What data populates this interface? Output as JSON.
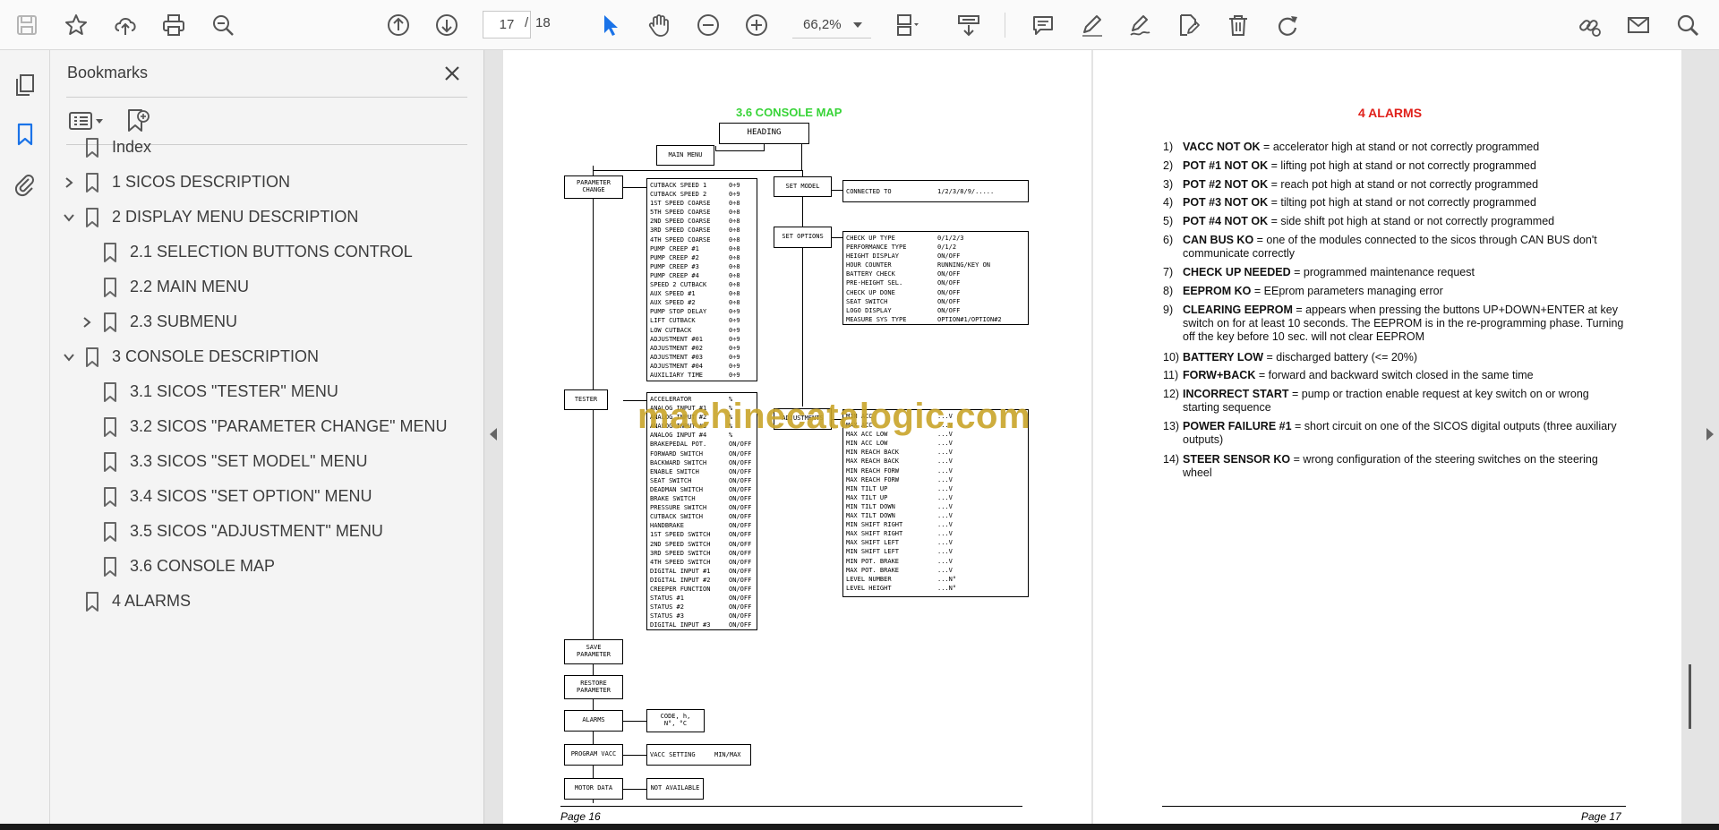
{
  "toolbar": {
    "page_current": "17",
    "page_sep": "/",
    "page_total": "18",
    "zoom": "66,2%",
    "accent": "#1a73e8"
  },
  "bookmarks": {
    "title": "Bookmarks",
    "items": [
      {
        "label": "Index",
        "level": 0,
        "chevron": "none"
      },
      {
        "label": "1 SICOS DESCRIPTION",
        "level": 0,
        "chevron": "right"
      },
      {
        "label": "2 DISPLAY MENU DESCRIPTION",
        "level": 0,
        "chevron": "down"
      },
      {
        "label": "2.1 SELECTION BUTTONS CONTROL",
        "level": 1,
        "chevron": "none"
      },
      {
        "label": "2.2 MAIN MENU",
        "level": 1,
        "chevron": "none"
      },
      {
        "label": "2.3 SUBMENU",
        "level": 1,
        "chevron": "right"
      },
      {
        "label": "3 CONSOLE DESCRIPTION",
        "level": 0,
        "chevron": "down"
      },
      {
        "label": "3.1 SICOS \"TESTER\" MENU",
        "level": 1,
        "chevron": "none"
      },
      {
        "label": "3.2 SICOS \"PARAMETER CHANGE\" MENU",
        "level": 1,
        "chevron": "none"
      },
      {
        "label": "3.3 SICOS \"SET MODEL\" MENU",
        "level": 1,
        "chevron": "none"
      },
      {
        "label": "3.4 SICOS \"SET OPTION\" MENU",
        "level": 1,
        "chevron": "none"
      },
      {
        "label": "3.5 SICOS \"ADJUSTMENT\" MENU",
        "level": 1,
        "chevron": "none"
      },
      {
        "label": "3.6 CONSOLE MAP",
        "level": 1,
        "chevron": "none"
      },
      {
        "label": "4 ALARMS",
        "level": 0,
        "chevron": "none"
      }
    ]
  },
  "page16": {
    "title": "3.6 CONSOLE MAP",
    "heading": "HEADING",
    "main_menu": "MAIN MENU",
    "parameter_change": "PARAMETER CHANGE",
    "set_model": "SET MODEL",
    "set_options": "SET OPTIONS",
    "tester": "TESTER",
    "adjustments": "ADJUSTMENTS",
    "save_parameter": "SAVE PARAMETER",
    "restore_parameter": "RESTORE PARAMETER",
    "alarms": "ALARMS",
    "program_vacc": "PROGRAM VACC",
    "motor_data": "MOTOR DATA",
    "connected_to": {
      "k": "CONNECTED TO",
      "v": "1/2/3/8/9/....."
    },
    "alarm_code": "CODE, h, N°, °C",
    "vacc_setting": {
      "k": "VACC SETTING",
      "v": "MIN/MAX"
    },
    "not_available": "NOT AVAILABLE",
    "param_list": [
      {
        "k": "CUTBACK SPEED 1",
        "v": "0÷9"
      },
      {
        "k": "CUTBACK SPEED 2",
        "v": "0÷9"
      },
      {
        "k": "1ST SPEED COARSE",
        "v": "0÷8"
      },
      {
        "k": "5TH SPEED COARSE",
        "v": "0÷8"
      },
      {
        "k": "2ND SPEED COARSE",
        "v": "0÷8"
      },
      {
        "k": "3RD SPEED COARSE",
        "v": "0÷8"
      },
      {
        "k": "4TH SPEED COARSE",
        "v": "0÷8"
      },
      {
        "k": "PUMP CREEP #1",
        "v": "0÷8"
      },
      {
        "k": "PUMP CREEP #2",
        "v": "0÷8"
      },
      {
        "k": "PUMP CREEP #3",
        "v": "0÷8"
      },
      {
        "k": "PUMP CREEP #4",
        "v": "0÷8"
      },
      {
        "k": "SPEED 2 CUTBACK",
        "v": "0÷8"
      },
      {
        "k": "AUX SPEED #1",
        "v": "0÷8"
      },
      {
        "k": "AUX SPEED #2",
        "v": "0÷8"
      },
      {
        "k": "PUMP STOP DELAY",
        "v": "0÷9"
      },
      {
        "k": "LIFT CUTBACK",
        "v": "0÷9"
      },
      {
        "k": "LOW CUTBACK",
        "v": "0÷9"
      },
      {
        "k": "ADJUSTMENT #01",
        "v": "0÷9"
      },
      {
        "k": "ADJUSTMENT #02",
        "v": "0÷9"
      },
      {
        "k": "ADJUSTMENT #03",
        "v": "0÷9"
      },
      {
        "k": "ADJUSTMENT #04",
        "v": "0÷9"
      },
      {
        "k": "AUXILIARY TIME",
        "v": "0÷9"
      }
    ],
    "option_list": [
      {
        "k": "CHECK UP TYPE",
        "v": "0/1/2/3"
      },
      {
        "k": "PERFORMANCE TYPE",
        "v": "0/1/2"
      },
      {
        "k": "HEIGHT DISPLAY",
        "v": "ON/OFF"
      },
      {
        "k": "HOUR COUNTER",
        "v": "RUNNING/KEY ON"
      },
      {
        "k": "BATTERY CHECK",
        "v": "ON/OFF"
      },
      {
        "k": "PRE-HEIGHT SEL.",
        "v": "ON/OFF"
      },
      {
        "k": "CHECK UP DONE",
        "v": "ON/OFF"
      },
      {
        "k": "SEAT SWITCH",
        "v": "ON/OFF"
      },
      {
        "k": "LOGO DISPLAY",
        "v": "ON/OFF"
      },
      {
        "k": "MEASURE SYS TYPE",
        "v": "OPTION#1/OPTION#2"
      }
    ],
    "tester_list": [
      {
        "k": "ACCELERATOR",
        "v": "%"
      },
      {
        "k": "ANALOG INPUT #1",
        "v": "%"
      },
      {
        "k": "ANALOG INPUT #2",
        "v": "%"
      },
      {
        "k": "ANALOG INPUT #3",
        "v": "%"
      },
      {
        "k": "ANALOG INPUT #4",
        "v": "%"
      },
      {
        "k": "BRAKEPEDAL POT.",
        "v": "ON/OFF"
      },
      {
        "k": "FORWARD SWITCH",
        "v": "ON/OFF"
      },
      {
        "k": "BACKWARD SWITCH",
        "v": "ON/OFF"
      },
      {
        "k": "ENABLE SWITCH",
        "v": "ON/OFF"
      },
      {
        "k": "SEAT SWITCH",
        "v": "ON/OFF"
      },
      {
        "k": "DEADMAN SWITCH",
        "v": "ON/OFF"
      },
      {
        "k": "BRAKE SWITCH",
        "v": "ON/OFF"
      },
      {
        "k": "PRESSURE SWITCH",
        "v": "ON/OFF"
      },
      {
        "k": "CUTBACK SWITCH",
        "v": "ON/OFF"
      },
      {
        "k": "HANDBRAKE",
        "v": "ON/OFF"
      },
      {
        "k": "1ST SPEED SWITCH",
        "v": "ON/OFF"
      },
      {
        "k": "2ND SPEED SWITCH",
        "v": "ON/OFF"
      },
      {
        "k": "3RD SPEED SWITCH",
        "v": "ON/OFF"
      },
      {
        "k": "4TH SPEED SWITCH",
        "v": "ON/OFF"
      },
      {
        "k": "DIGITAL INPUT #1",
        "v": "ON/OFF"
      },
      {
        "k": "DIGITAL INPUT #2",
        "v": "ON/OFF"
      },
      {
        "k": "CREEPER FUNCTION",
        "v": "ON/OFF"
      },
      {
        "k": "STATUS #1",
        "v": "ON/OFF"
      },
      {
        "k": "STATUS #2",
        "v": "ON/OFF"
      },
      {
        "k": "STATUS #3",
        "v": "ON/OFF"
      },
      {
        "k": "DIGITAL INPUT #3",
        "v": "ON/OFF"
      }
    ],
    "adjust_list": [
      {
        "k": "MIN ACC",
        "v": "...V"
      },
      {
        "k": "MAX ACC",
        "v": "...V"
      },
      {
        "k": "MAX ACC LOW",
        "v": "...V"
      },
      {
        "k": "MIN ACC LOW",
        "v": "...V"
      },
      {
        "k": "MIN REACH BACK",
        "v": "...V"
      },
      {
        "k": "MAX REACH BACK",
        "v": "...V"
      },
      {
        "k": "MIN REACH FORW",
        "v": "...V"
      },
      {
        "k": "MAX REACH FORW",
        "v": "...V"
      },
      {
        "k": "MIN TILT UP",
        "v": "...V"
      },
      {
        "k": "MAX TILT UP",
        "v": "...V"
      },
      {
        "k": "MIN TILT DOWN",
        "v": "...V"
      },
      {
        "k": "MAX TILT DOWN",
        "v": "...V"
      },
      {
        "k": "MIN SHIFT RIGHT",
        "v": "...V"
      },
      {
        "k": "MAX SHIFT RIGHT",
        "v": "...V"
      },
      {
        "k": "MAX SHIFT LEFT",
        "v": "...V"
      },
      {
        "k": "MIN SHIFT LEFT",
        "v": "...V"
      },
      {
        "k": "MIN POT. BRAKE",
        "v": "...V"
      },
      {
        "k": "MAX POT. BRAKE",
        "v": "...V"
      },
      {
        "k": "LEVEL NUMBER",
        "v": "...N°"
      },
      {
        "k": "LEVEL HEIGHT",
        "v": "...N°"
      }
    ],
    "watermark": "machinecatalogic.com",
    "footer": "Page 16"
  },
  "page17": {
    "title": "4 ALARMS",
    "items": [
      {
        "n": "1)",
        "b": "VACC NOT OK",
        "t": " = accelerator high at stand or not correctly programmed"
      },
      {
        "n": "2)",
        "b": "POT #1 NOT OK",
        "t": " = lifting pot high at stand or not correctly programmed"
      },
      {
        "n": "3)",
        "b": "POT #2 NOT OK",
        "t": " = reach pot high at stand or not correctly programmed"
      },
      {
        "n": "4)",
        "b": "POT #3 NOT OK",
        "t": " = tilting pot high at stand or not correctly programmed"
      },
      {
        "n": "5)",
        "b": "POT #4 NOT OK",
        "t": " = side shift pot high at stand or not correctly programmed"
      },
      {
        "n": "6)",
        "b": "CAN BUS KO",
        "t": " = one of the modules connected to the sicos through CAN BUS don't communicate correctly"
      },
      {
        "n": "7)",
        "b": "CHECK UP NEEDED",
        "t": " = programmed maintenance request"
      },
      {
        "n": "8)",
        "b": "EEPROM KO",
        "t": " = EEprom parameters managing error"
      },
      {
        "n": "9)",
        "b": "CLEARING EEPROM",
        "t": " = appears when pressing the buttons UP+DOWN+ENTER at key switch on  for at least 10 seconds. The EEPROM is in the re-programming phase. Turning off the key before 10 sec. will not clear EEPROM"
      },
      {
        "n": "10)",
        "b": "BATTERY LOW",
        "t": " = discharged battery (<= 20%)"
      },
      {
        "n": "11)",
        "b": "FORW+BACK",
        "t": " = forward and backward switch closed in the same time"
      },
      {
        "n": "12)",
        "b": "INCORRECT START",
        "t": " = pump or traction enable request at key switch on or wrong starting sequence"
      },
      {
        "n": "13)",
        "b": "POWER FAILURE #1",
        "t": " = short circuit on one of the SICOS digital outputs (three auxiliary outputs)"
      },
      {
        "n": "14)",
        "b": "STEER SENSOR KO",
        "t": " = wrong configuration of the steering switches on the steering wheel"
      }
    ],
    "footer": "Page 17"
  }
}
